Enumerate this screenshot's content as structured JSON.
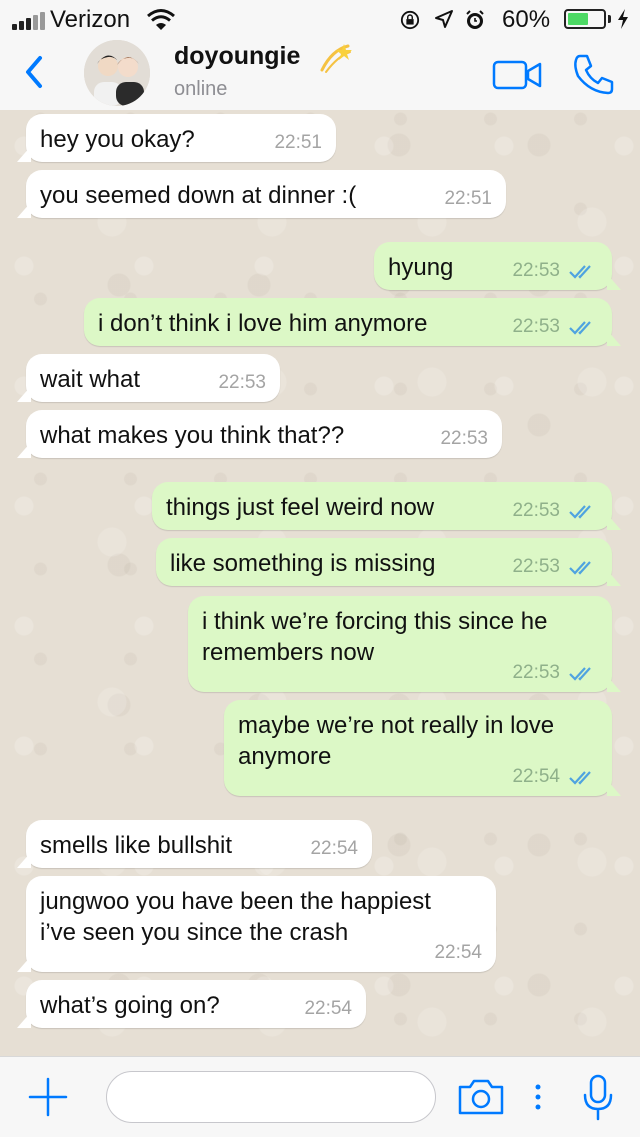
{
  "status_bar": {
    "carrier": "Verizon",
    "battery_percent": "60%",
    "battery_level": 0.6,
    "icons": [
      "signal-bars-icon",
      "wifi-icon",
      "rotation-lock-icon",
      "location-arrow-icon",
      "alarm-icon",
      "battery-icon",
      "charging-bolt-icon"
    ]
  },
  "header": {
    "contact_name": "doyoungie",
    "name_emoji": "dizzy-comet-emoji",
    "status": "online",
    "icons": [
      "back-chevron-icon",
      "video-call-icon",
      "phone-call-icon"
    ]
  },
  "messages": [
    {
      "direction": "in",
      "text": "hey you okay?",
      "time": "22:51"
    },
    {
      "direction": "in",
      "text": "you seemed down at dinner :(",
      "time": "22:51"
    },
    {
      "direction": "out",
      "text": "hyung",
      "time": "22:53",
      "read": true
    },
    {
      "direction": "out",
      "text": "i don’t think i love him anymore",
      "time": "22:53",
      "read": true
    },
    {
      "direction": "in",
      "text": "wait what",
      "time": "22:53"
    },
    {
      "direction": "in",
      "text": "what makes you think that??",
      "time": "22:53"
    },
    {
      "direction": "out",
      "text": "things just feel weird now",
      "time": "22:53",
      "read": true
    },
    {
      "direction": "out",
      "text": "like something is missing",
      "time": "22:53",
      "read": true
    },
    {
      "direction": "out",
      "text": "i think we’re forcing this since he\nremembers now",
      "time": "22:53",
      "read": true
    },
    {
      "direction": "out",
      "text": "maybe we’re not really in love\nanymore",
      "time": "22:54",
      "read": true
    },
    {
      "direction": "in",
      "text": "smells like bullshit",
      "time": "22:54"
    },
    {
      "direction": "in",
      "text": "jungwoo you have been the happiest\ni’ve seen you since the crash",
      "time": "22:54"
    },
    {
      "direction": "in",
      "text": "what’s going on?",
      "time": "22:54"
    }
  ],
  "input_bar": {
    "placeholder": "",
    "icons": [
      "plus-icon",
      "camera-icon",
      "more-dots-icon",
      "microphone-icon"
    ]
  },
  "colors": {
    "accent": "#007aff",
    "outgoing_bubble": "#dcf8c6",
    "incoming_bubble": "#ffffff",
    "chat_background": "#e6dfd4",
    "read_ticks": "#4fa3e0",
    "battery_fill": "#4cd964"
  }
}
